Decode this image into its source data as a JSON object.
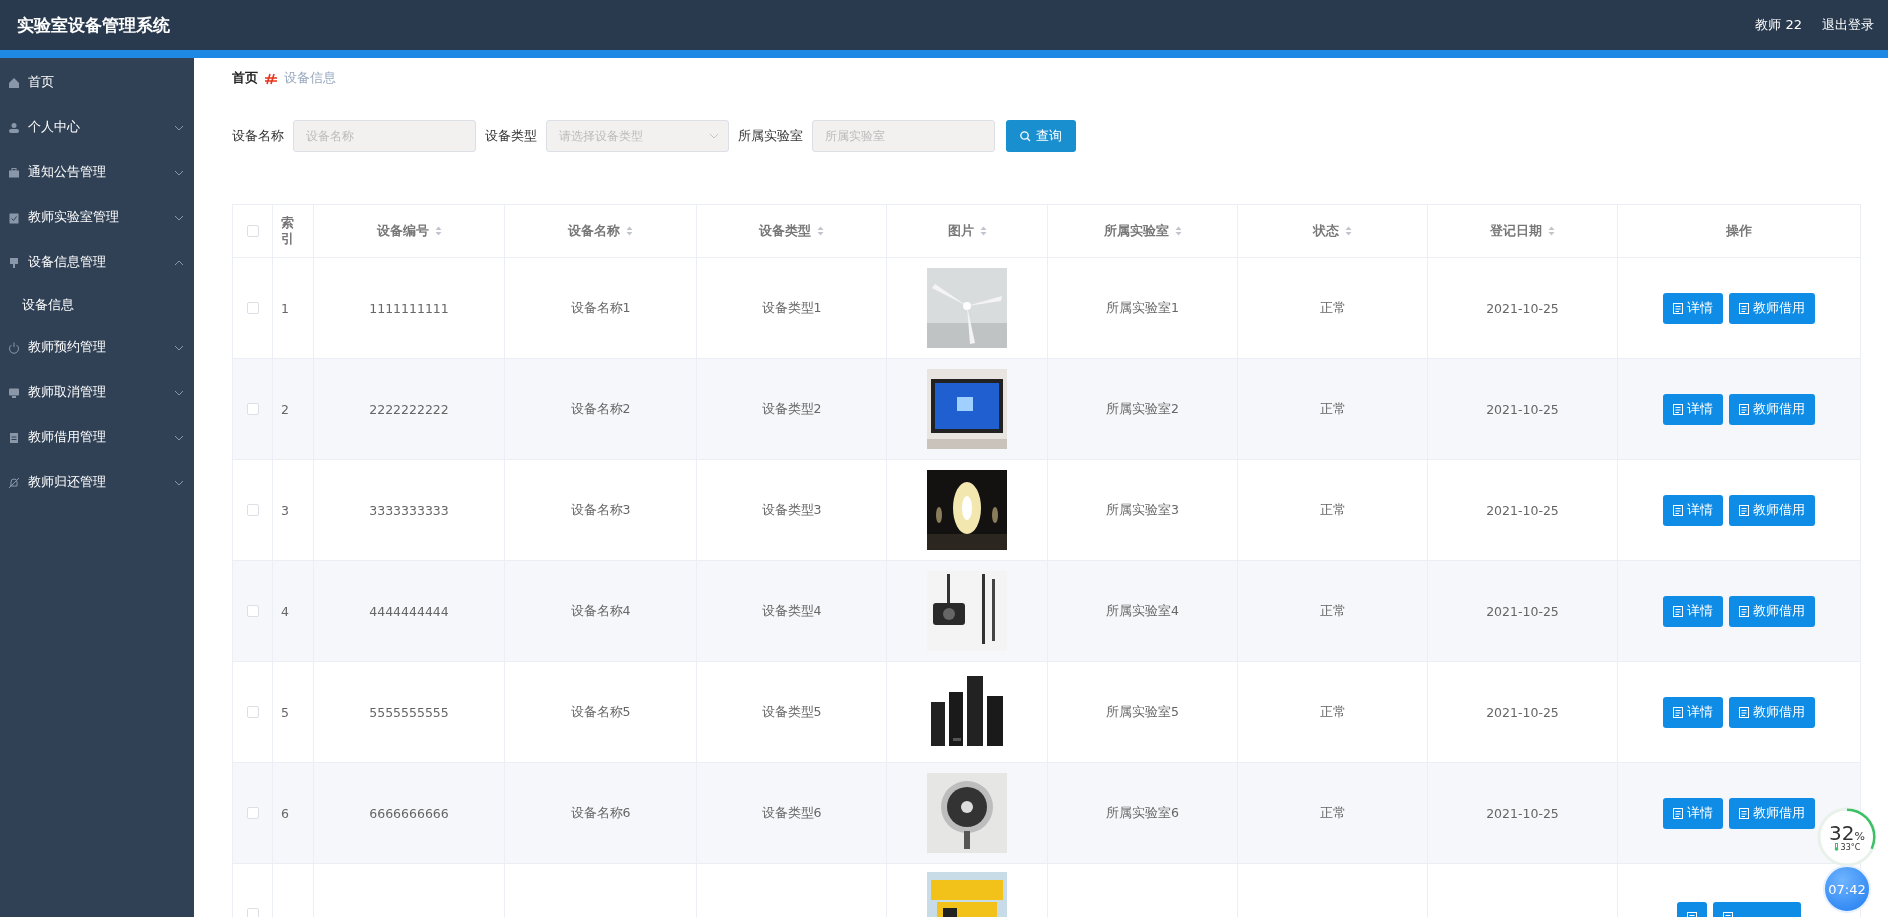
{
  "header": {
    "title": "实验室设备管理系统",
    "user": "教师 22",
    "logout": "退出登录"
  },
  "sidebar": {
    "items": [
      {
        "label": "首页",
        "kind": "link"
      },
      {
        "label": "个人中心",
        "kind": "menu",
        "expanded": false
      },
      {
        "label": "通知公告管理",
        "kind": "menu",
        "expanded": false
      },
      {
        "label": "教师实验室管理",
        "kind": "menu",
        "expanded": false
      },
      {
        "label": "设备信息管理",
        "kind": "menu",
        "expanded": true,
        "children": [
          {
            "label": "设备信息"
          }
        ]
      },
      {
        "label": "教师预约管理",
        "kind": "menu",
        "expanded": false
      },
      {
        "label": "教师取消管理",
        "kind": "menu",
        "expanded": false
      },
      {
        "label": "教师借用管理",
        "kind": "menu",
        "expanded": false
      },
      {
        "label": "教师归还管理",
        "kind": "menu",
        "expanded": false
      }
    ]
  },
  "breadcrumb": [
    "首页",
    "设备信息"
  ],
  "search": {
    "fields": [
      {
        "label": "设备名称",
        "placeholder": "设备名称",
        "kind": "text"
      },
      {
        "label": "设备类型",
        "placeholder": "请选择设备类型",
        "kind": "select"
      },
      {
        "label": "所属实验室",
        "placeholder": "所属实验室",
        "kind": "text"
      }
    ],
    "button": "查询"
  },
  "table": {
    "select_all": {
      "checked": false
    },
    "columns": [
      {
        "label": "索引",
        "sortable": false
      },
      {
        "label": "设备编号",
        "sortable": true
      },
      {
        "label": "设备名称",
        "sortable": true
      },
      {
        "label": "设备类型",
        "sortable": true
      },
      {
        "label": "图片",
        "sortable": true
      },
      {
        "label": "所属实验室",
        "sortable": true
      },
      {
        "label": "状态",
        "sortable": true
      },
      {
        "label": "登记日期",
        "sortable": true
      },
      {
        "label": "操作",
        "sortable": false
      }
    ],
    "rows": [
      {
        "kind": "full",
        "checked": false,
        "cells": [
          "1",
          "1111111111",
          "设备名称1",
          "设备类型1",
          "所属实验室1",
          "正常",
          "2021-10-25"
        ],
        "actions": [
          "详情",
          "教师借用"
        ]
      },
      {
        "kind": "full",
        "checked": false,
        "cells": [
          "2",
          "2222222222",
          "设备名称2",
          "设备类型2",
          "所属实验室2",
          "正常",
          "2021-10-25"
        ],
        "actions": [
          "详情",
          "教师借用"
        ]
      },
      {
        "kind": "full",
        "checked": false,
        "cells": [
          "3",
          "3333333333",
          "设备名称3",
          "设备类型3",
          "所属实验室3",
          "正常",
          "2021-10-25"
        ],
        "actions": [
          "详情",
          "教师借用"
        ]
      },
      {
        "kind": "full",
        "checked": false,
        "cells": [
          "4",
          "4444444444",
          "设备名称4",
          "设备类型4",
          "所属实验室4",
          "正常",
          "2021-10-25"
        ],
        "actions": [
          "详情",
          "教师借用"
        ]
      },
      {
        "kind": "full",
        "checked": false,
        "cells": [
          "5",
          "5555555555",
          "设备名称5",
          "设备类型5",
          "所属实验室5",
          "正常",
          "2021-10-25"
        ],
        "actions": [
          "详情",
          "教师借用"
        ]
      },
      {
        "kind": "full",
        "checked": false,
        "cells": [
          "6",
          "6666666666",
          "设备名称6",
          "设备类型6",
          "所属实验室6",
          "正常",
          "2021-10-25"
        ],
        "actions": [
          "详情",
          "教师借用"
        ]
      },
      {
        "kind": "cut",
        "checked": false
      }
    ]
  },
  "widget": {
    "value": "32",
    "unit": "%",
    "temperature": "33°C",
    "level": 0.32,
    "time": "07:42"
  }
}
